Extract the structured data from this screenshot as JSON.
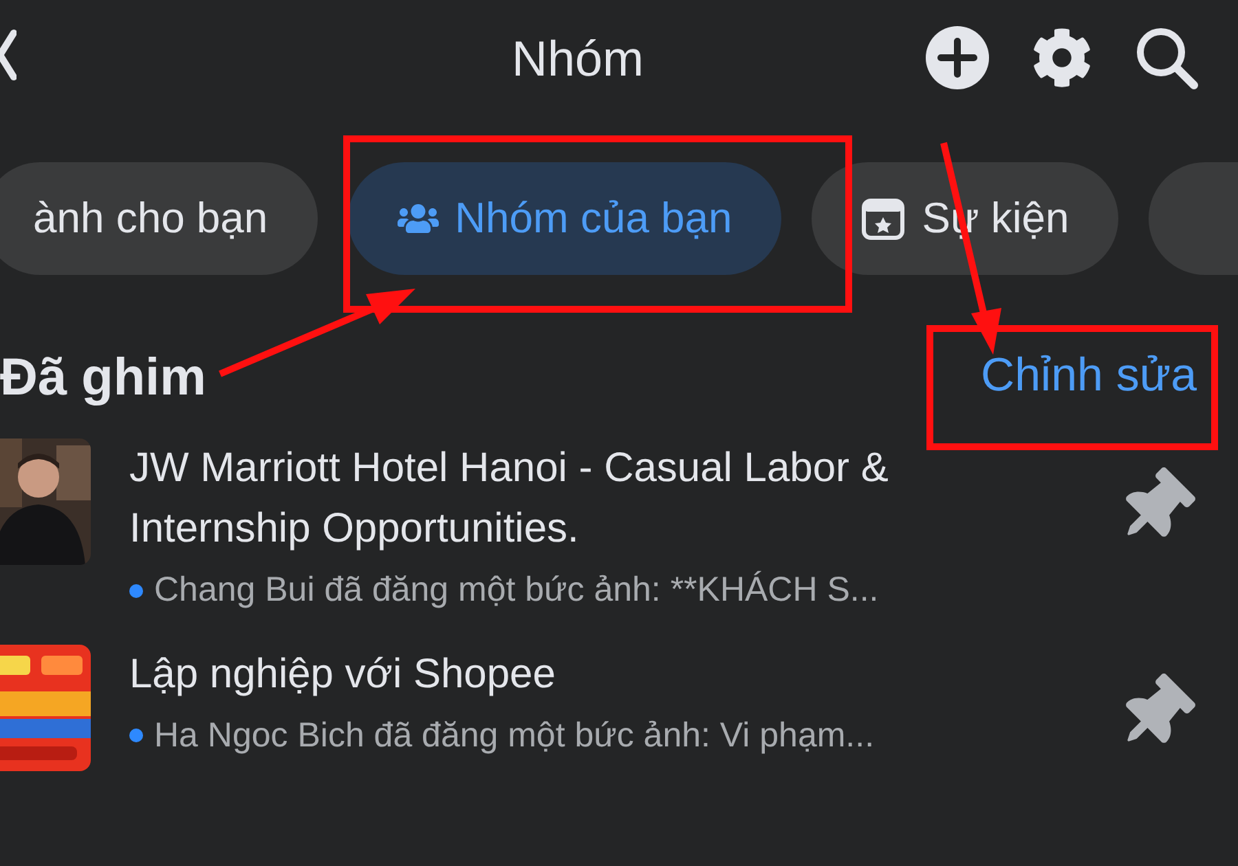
{
  "header": {
    "title": "Nhóm"
  },
  "tabs": [
    {
      "label": "ành cho bạn",
      "selected": false,
      "kind": "plain"
    },
    {
      "label": "Nhóm của bạn",
      "selected": true,
      "kind": "groups"
    },
    {
      "label": "Sự kiện",
      "selected": false,
      "kind": "events"
    }
  ],
  "pinned": {
    "heading": "Đã ghim",
    "edit_link": "Chỉnh sửa",
    "groups": [
      {
        "name": "JW Marriott Hotel Hanoi - Casual Labor & Internship Opportunities.",
        "activity": "Chang Bui đã đăng một bức ảnh: **KHÁCH S...",
        "unread": true,
        "thumbnail": {
          "kind": "person"
        }
      },
      {
        "name": "Lập nghiệp với Shopee",
        "activity": "Ha Ngoc Bich đã đăng một bức ảnh: Vi phạm...",
        "unread": true,
        "thumbnail": {
          "kind": "poster"
        }
      }
    ]
  }
}
